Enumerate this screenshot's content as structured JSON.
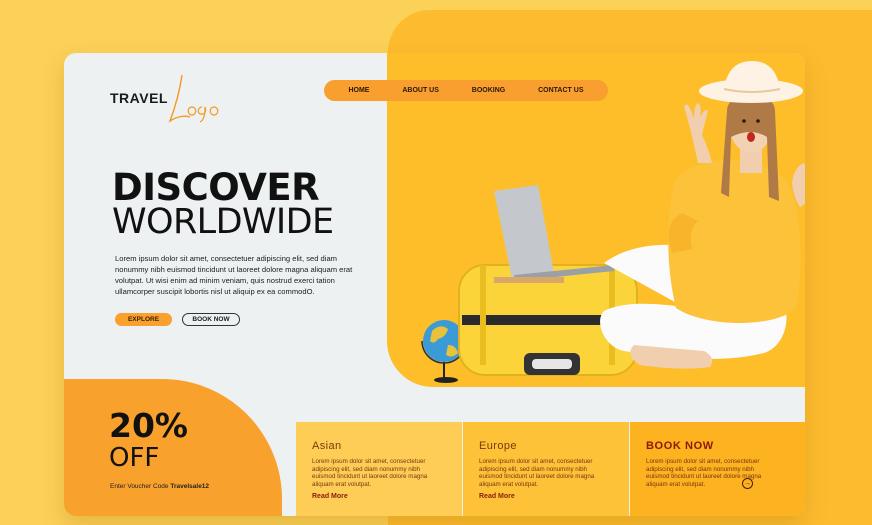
{
  "brand": {
    "logo_text": "TRAVEL",
    "logo_script": "Logo"
  },
  "nav": {
    "items": [
      "HOME",
      "ABOUT US",
      "BOOKING",
      "CONTACT US"
    ]
  },
  "hero": {
    "title_line1": "DISCOVER",
    "title_line2": "WORLDWIDE",
    "body": "Lorem ipsum dolor sit amet, consectetuer adipiscing elit, sed diam nonummy nibh euismod tincidunt ut laoreet dolore magna aliquam erat volutpat. Ut wisi enim ad minim veniam, quis nostrud exerci tation ullamcorper suscipit lobortis nisl ut aliquip ex ea commodO.",
    "explore_label": "EXPLORE",
    "book_label": "BOOK NOW"
  },
  "promo": {
    "percent": "20%",
    "off": "OFF",
    "voucher_prefix": "Enter Voucher Code",
    "voucher_code": "Travelsale12"
  },
  "columns": [
    {
      "title": "Asian",
      "text": "Lorem ipsum dolor sit amet, consectetuer adipiscing elit, sed diam nonummy nibh euismod tincidunt ut laoreet dolore magna aliquam erat volutpat.",
      "link": "Read More"
    },
    {
      "title": "Europe",
      "text": "Lorem ipsum dolor sit amet, consectetuer adipiscing elit, sed diam nonummy nibh euismod tincidunt ut laoreet dolore magna aliquam erat volutpat.",
      "link": "Read More"
    },
    {
      "title": "BOOK NOW",
      "text": "Lorem ipsum dolor sit amet, consectetuer adipiscing elit, sed diam nonummy nibh euismod tincidunt ut laoreet dolore magna aliquam erat volutpat."
    }
  ],
  "icons": {
    "arrow": "arrow-right-circle-icon"
  },
  "colors": {
    "accent": "#f99f2f",
    "hero_panel": "#fdbe2a",
    "background": "#fcd158"
  }
}
